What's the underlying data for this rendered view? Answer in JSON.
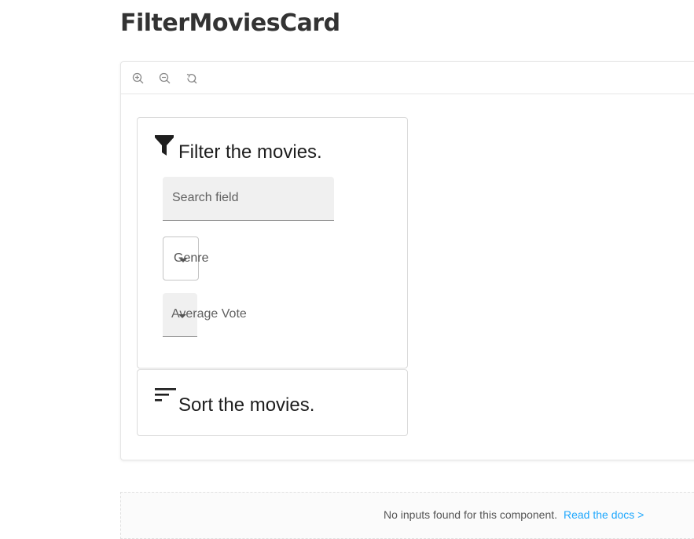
{
  "page": {
    "title": "FilterMoviesCard"
  },
  "toolbar": {
    "zoom_in_icon": "zoom-in-icon",
    "zoom_out_icon": "zoom-out-icon",
    "reset_icon": "reset-zoom-icon"
  },
  "filter_card": {
    "icon": "filter-icon",
    "title": "Filter the movies.",
    "search_field": {
      "label": "Search field",
      "value": ""
    },
    "genre_select": {
      "label": "Genre",
      "value": ""
    },
    "vote_select": {
      "label": "Average Vote",
      "value": ""
    }
  },
  "sort_card": {
    "icon": "sort-icon",
    "title": "Sort the movies."
  },
  "docs": {
    "message": "No inputs found for this component.",
    "link": "Read the docs >"
  },
  "colors": {
    "link": "#1ea7fd",
    "field_bg": "#f0f0f0",
    "title": "#333333"
  }
}
